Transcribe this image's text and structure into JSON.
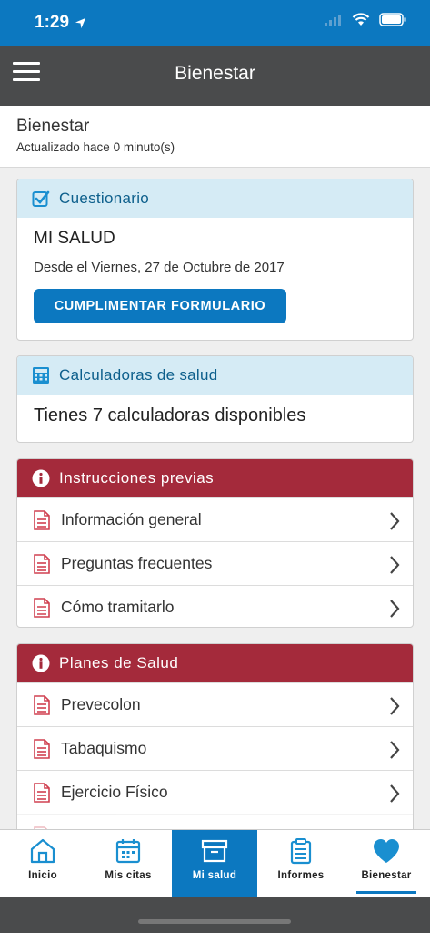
{
  "status_bar": {
    "time": "1:29"
  },
  "nav": {
    "title": "Bienestar"
  },
  "header": {
    "title": "Bienestar",
    "subtitle": "Actualizado hace 0 minuto(s)"
  },
  "questionnaire": {
    "heading": "Cuestionario",
    "title": "MI SALUD",
    "date": "Desde el Viernes, 27 de Octubre de 2017",
    "button": "CUMPLIMENTAR FORMULARIO"
  },
  "calculators": {
    "heading": "Calculadoras de salud",
    "text": "Tienes 7 calculadoras disponibles"
  },
  "instructions": {
    "heading": "Instrucciones previas",
    "items": [
      {
        "label": "Información general"
      },
      {
        "label": "Preguntas frecuentes"
      },
      {
        "label": "Cómo tramitarlo"
      }
    ]
  },
  "plans": {
    "heading": "Planes de Salud",
    "items": [
      {
        "label": "Prevecolon"
      },
      {
        "label": "Tabaquismo"
      },
      {
        "label": "Ejercicio Físico"
      }
    ]
  },
  "tabs": [
    {
      "label": "Inicio",
      "icon": "home-icon"
    },
    {
      "label": "Mis citas",
      "icon": "calendar-icon"
    },
    {
      "label": "Mi salud",
      "icon": "archive-box-icon"
    },
    {
      "label": "Informes",
      "icon": "clipboard-icon"
    },
    {
      "label": "Bienestar",
      "icon": "heart-icon"
    }
  ],
  "colors": {
    "primary_blue": "#0c78c0",
    "nav_gray": "#4a4b4c",
    "section_red": "#a42a3b",
    "section_blue_bg": "#d5ebf5",
    "icon_red": "#d04050"
  }
}
